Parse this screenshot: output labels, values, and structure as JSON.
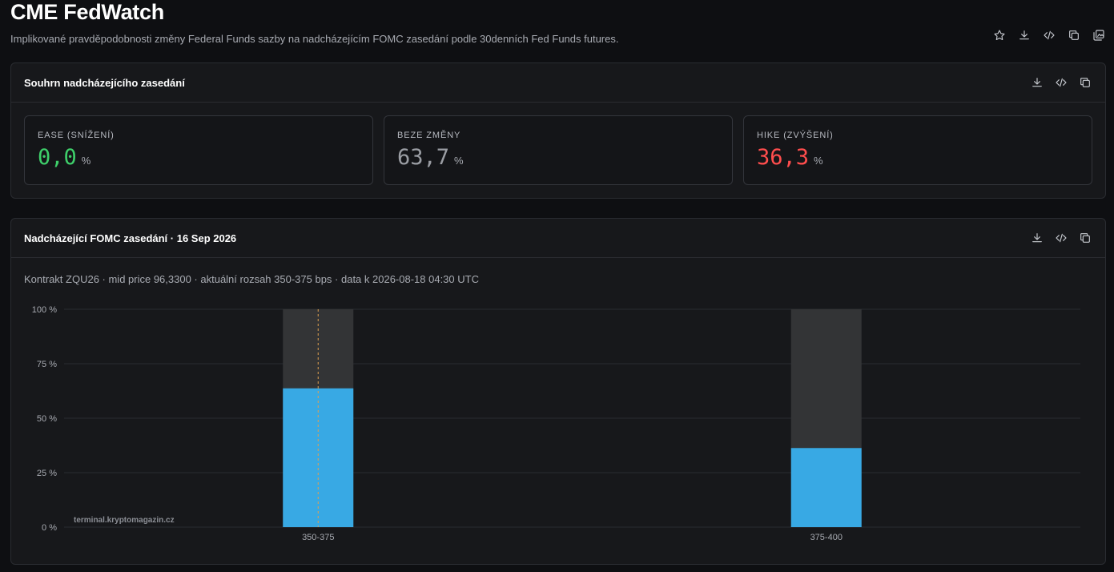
{
  "header": {
    "title": "CME FedWatch",
    "subtitle": "Implikované pravděpodobnosti změny Federal Funds sazby na nadcházejícím FOMC zasedání podle 30denních Fed Funds futures.",
    "actions": [
      "star-icon",
      "download-icon",
      "code-icon",
      "copy-icon",
      "gallery-icon"
    ]
  },
  "summary": {
    "title": "Souhrn nadcházejícího zasedání",
    "actions": [
      "download-icon",
      "code-icon",
      "copy-icon"
    ],
    "cards": [
      {
        "label": "EASE (SNÍŽENÍ)",
        "value": "0,0",
        "unit": "%",
        "color": "#3ecf6a"
      },
      {
        "label": "BEZE ZMĚNY",
        "value": "63,7",
        "unit": "%",
        "color": "#9a9da3"
      },
      {
        "label": "HIKE (ZVÝŠENÍ)",
        "value": "36,3",
        "unit": "%",
        "color": "#ff4d4d"
      }
    ]
  },
  "chart_panel": {
    "title": "Nadcházející FOMC zasedání · 16 Sep 2026",
    "actions": [
      "download-icon",
      "code-icon",
      "copy-icon"
    ],
    "meta": "Kontrakt ZQU26 · mid price 96,3300 · aktuální rozsah 350-375 bps · data k 2026-08-18 04:30 UTC",
    "watermark": "terminal.kryptomagazin.cz"
  },
  "chart_data": {
    "type": "bar",
    "categories": [
      "350-375",
      "375-400"
    ],
    "values": [
      63.7,
      36.3
    ],
    "ylim": [
      0,
      100
    ],
    "yticks": [
      0,
      25,
      50,
      75,
      100
    ],
    "ytick_labels": [
      "0 %",
      "25 %",
      "50 %",
      "75 %",
      "100 %"
    ],
    "current_range": "350-375",
    "colors": {
      "bar": "#38a9e4",
      "track": "#333436",
      "grid": "#2a2c30",
      "marker": "#e0a050",
      "tick": "#a8abb2"
    },
    "grid": true
  }
}
